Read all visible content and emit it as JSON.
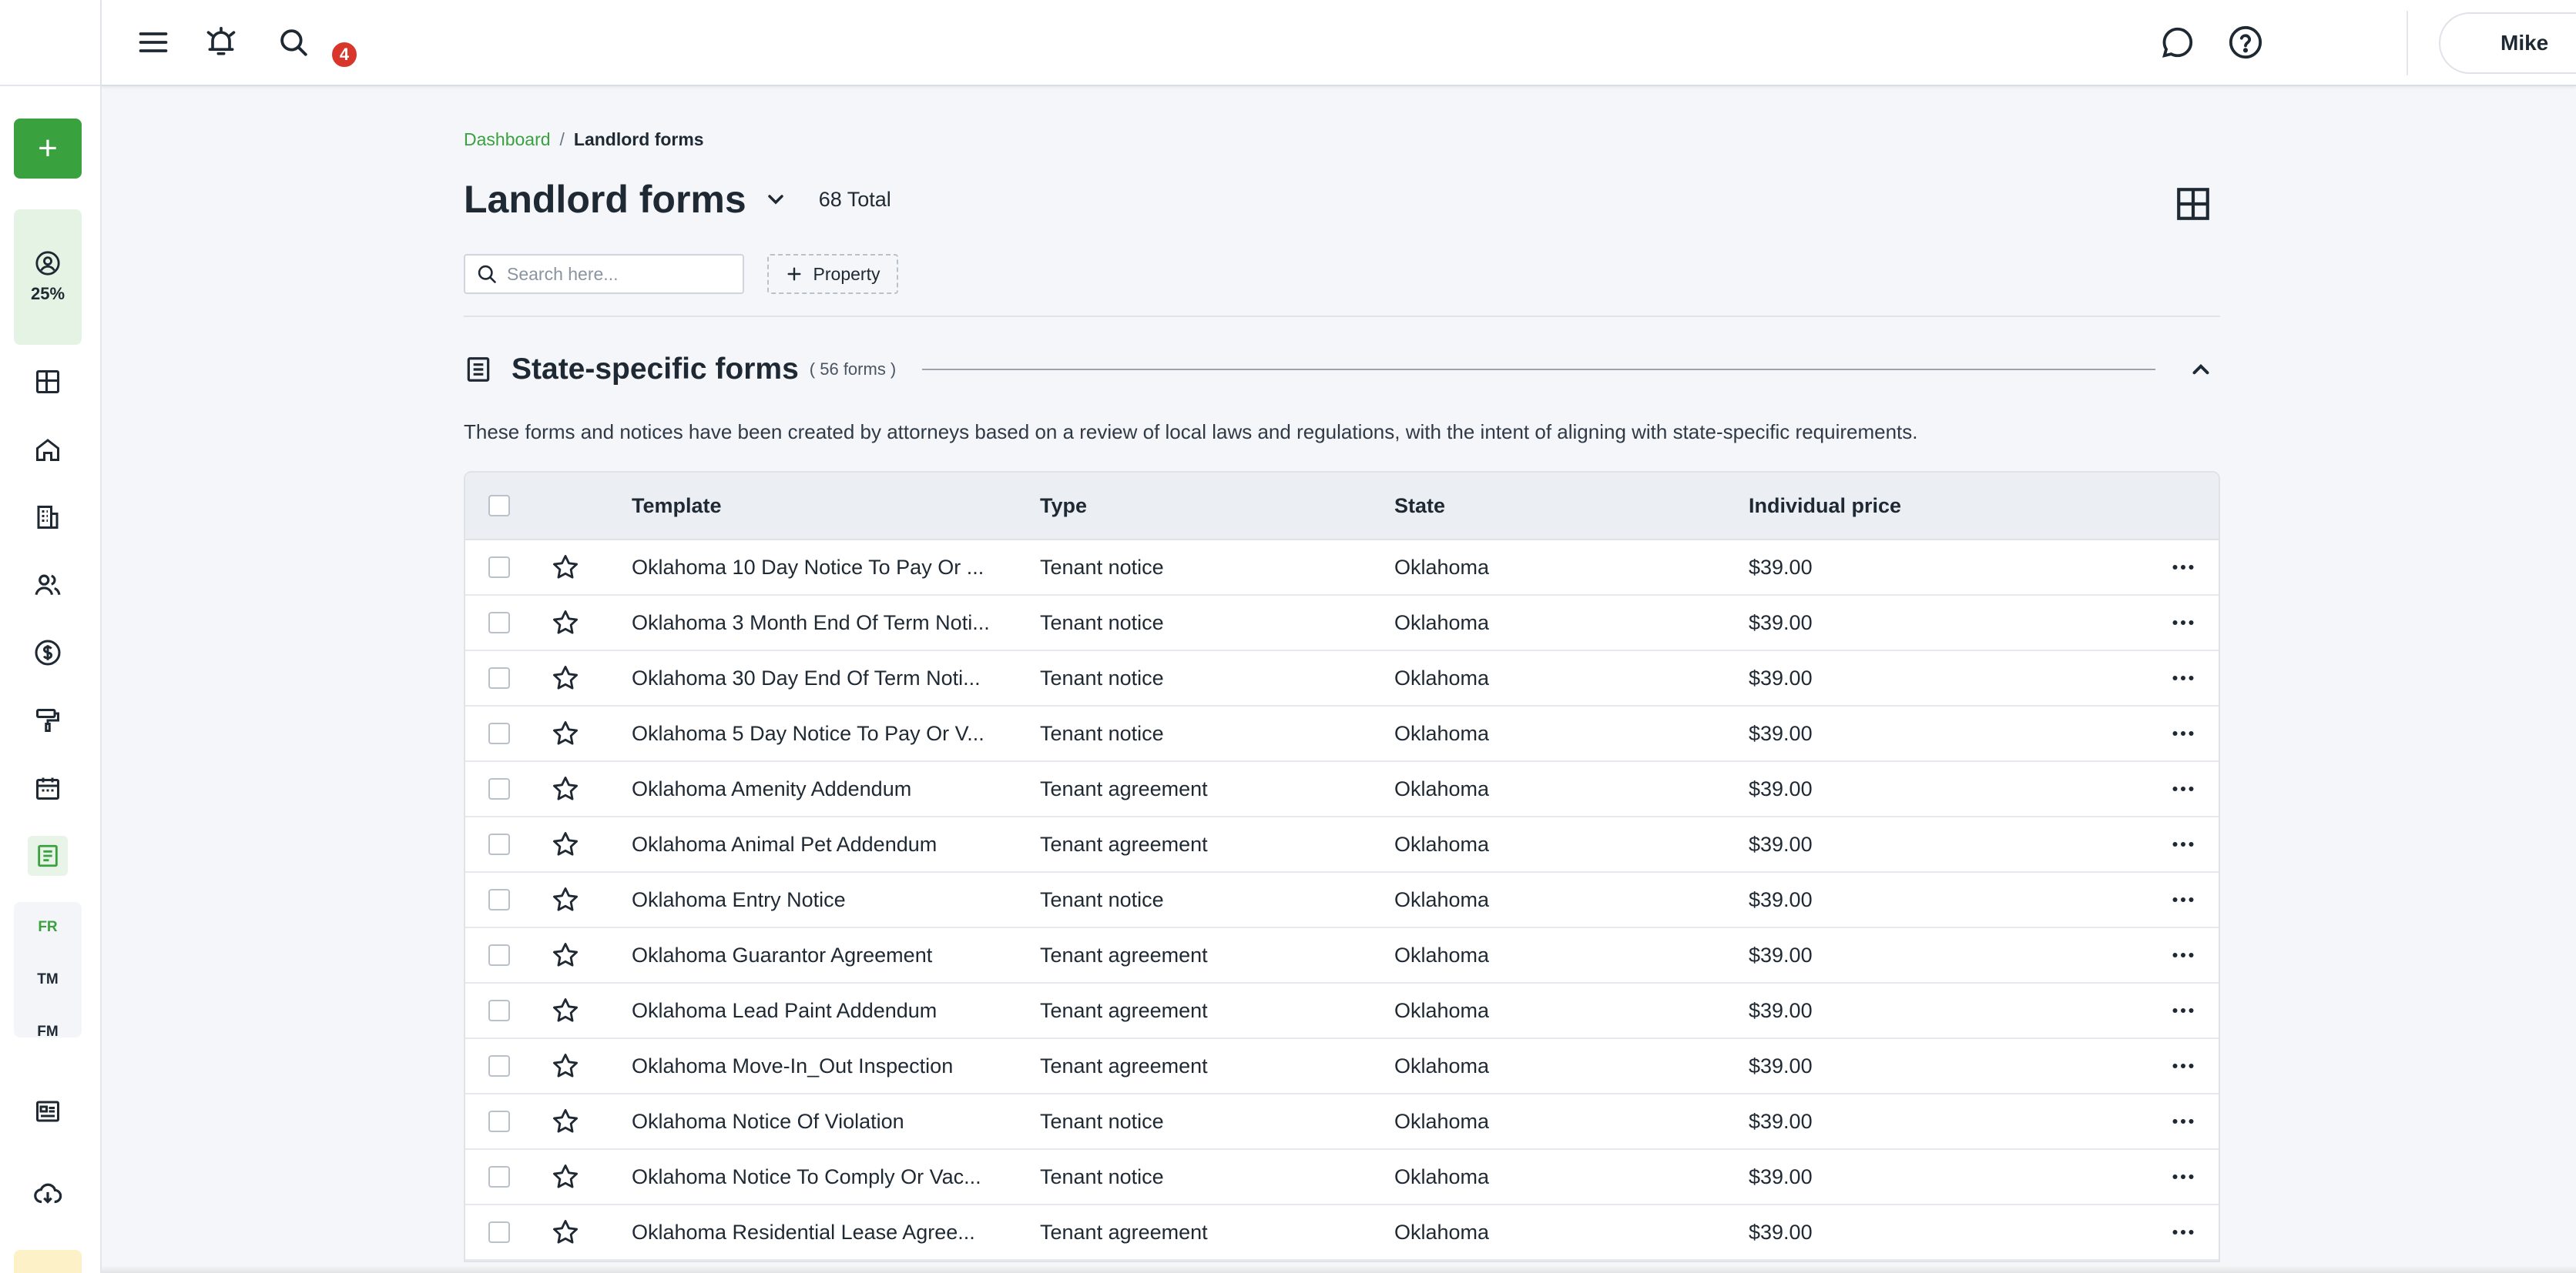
{
  "topbar": {
    "notification_count": "4",
    "user_name": "Mike"
  },
  "sidebar": {
    "add_label": "+",
    "progress_percent": "25%",
    "languages": [
      "FR",
      "TM",
      "FM"
    ],
    "active_language": "FR",
    "items": [
      "dashboard",
      "properties",
      "leases",
      "people",
      "accounting",
      "maintenance",
      "calendar",
      "forms",
      "reports",
      "downloads"
    ]
  },
  "breadcrumb": {
    "home": "Dashboard",
    "separator": "/",
    "current": "Landlord forms"
  },
  "header": {
    "title": "Landlord forms",
    "total": "68 Total"
  },
  "filters": {
    "search_placeholder": "Search here...",
    "property_button": "Property"
  },
  "section": {
    "title": "State-specific forms",
    "count": "( 56 forms )",
    "description": "These forms and notices have been created by attorneys based on a review of local laws and regulations, with the intent of aligning with state-specific requirements."
  },
  "table": {
    "columns": {
      "template": "Template",
      "type": "Type",
      "state": "State",
      "price": "Individual price"
    },
    "rows": [
      {
        "template": "Oklahoma 10 Day Notice To Pay Or ...",
        "type": "Tenant notice",
        "state": "Oklahoma",
        "price": "$39.00"
      },
      {
        "template": "Oklahoma 3 Month End Of Term Noti...",
        "type": "Tenant notice",
        "state": "Oklahoma",
        "price": "$39.00"
      },
      {
        "template": "Oklahoma 30 Day End Of Term Noti...",
        "type": "Tenant notice",
        "state": "Oklahoma",
        "price": "$39.00"
      },
      {
        "template": "Oklahoma 5 Day Notice To Pay Or V...",
        "type": "Tenant notice",
        "state": "Oklahoma",
        "price": "$39.00"
      },
      {
        "template": "Oklahoma Amenity Addendum",
        "type": "Tenant agreement",
        "state": "Oklahoma",
        "price": "$39.00"
      },
      {
        "template": "Oklahoma Animal Pet Addendum",
        "type": "Tenant agreement",
        "state": "Oklahoma",
        "price": "$39.00"
      },
      {
        "template": "Oklahoma Entry Notice",
        "type": "Tenant notice",
        "state": "Oklahoma",
        "price": "$39.00"
      },
      {
        "template": "Oklahoma Guarantor Agreement",
        "type": "Tenant agreement",
        "state": "Oklahoma",
        "price": "$39.00"
      },
      {
        "template": "Oklahoma Lead Paint Addendum",
        "type": "Tenant agreement",
        "state": "Oklahoma",
        "price": "$39.00"
      },
      {
        "template": "Oklahoma Move-In_Out Inspection",
        "type": "Tenant agreement",
        "state": "Oklahoma",
        "price": "$39.00"
      },
      {
        "template": "Oklahoma Notice Of Violation",
        "type": "Tenant notice",
        "state": "Oklahoma",
        "price": "$39.00"
      },
      {
        "template": "Oklahoma Notice To Comply Or Vac...",
        "type": "Tenant notice",
        "state": "Oklahoma",
        "price": "$39.00"
      },
      {
        "template": "Oklahoma Residential Lease Agree...",
        "type": "Tenant agreement",
        "state": "Oklahoma",
        "price": "$39.00"
      }
    ]
  },
  "colors": {
    "brand_green": "#3aa13f",
    "badge_red": "#d9362b",
    "page_bg": "#f4f6f9"
  }
}
